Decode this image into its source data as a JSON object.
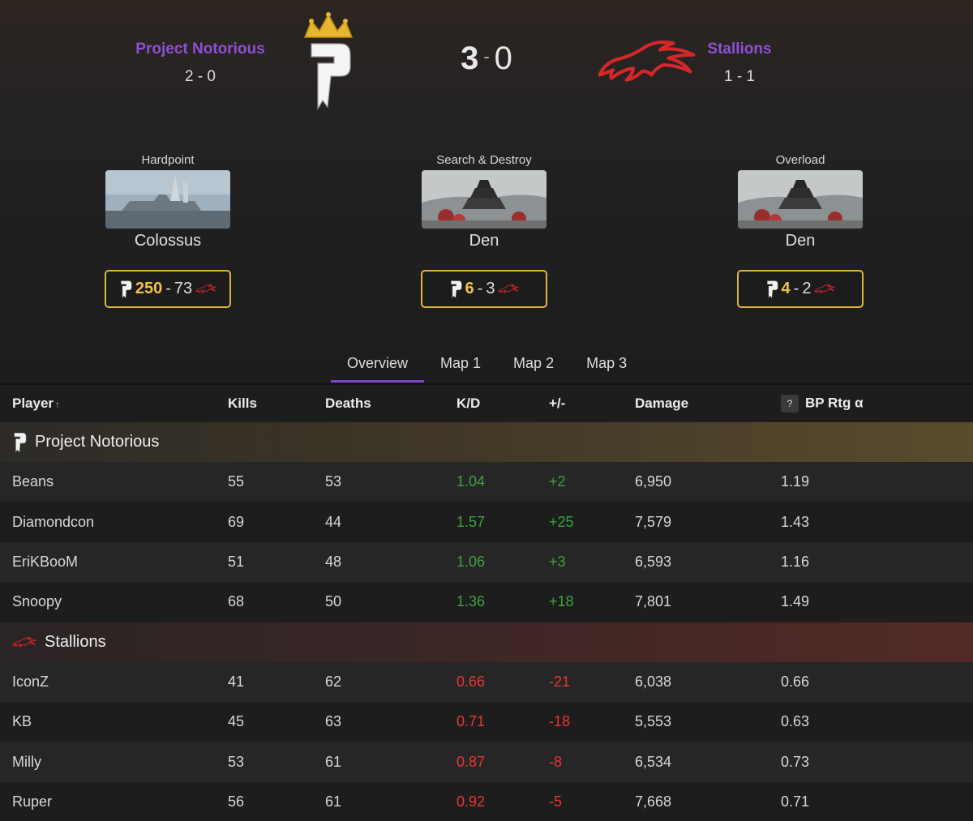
{
  "header": {
    "team1": {
      "name": "Project Notorious",
      "record": "2 - 0"
    },
    "team2": {
      "name": "Stallions",
      "record": "1 - 1"
    },
    "score": {
      "team1": "3",
      "separator": "-",
      "team2": "0"
    }
  },
  "maps": [
    {
      "mode": "Hardpoint",
      "name": "Colossus",
      "score_team1": "250",
      "separator": "-",
      "score_team2": "73"
    },
    {
      "mode": "Search & Destroy",
      "name": "Den",
      "score_team1": "6",
      "separator": "-",
      "score_team2": "3"
    },
    {
      "mode": "Overload",
      "name": "Den",
      "score_team1": "4",
      "separator": "-",
      "score_team2": "2"
    }
  ],
  "tabs": [
    {
      "label": "Overview",
      "active": true
    },
    {
      "label": "Map 1"
    },
    {
      "label": "Map 2"
    },
    {
      "label": "Map 3"
    }
  ],
  "table": {
    "columns": {
      "player": "Player",
      "kills": "Kills",
      "deaths": "Deaths",
      "kd": "K/D",
      "plus_minus": "+/-",
      "damage": "Damage",
      "help": "?",
      "bp_rating": "BP Rtg α"
    },
    "sort_indicator": "↑",
    "groups": [
      {
        "team": "Project Notorious",
        "players": [
          {
            "name": "Beans",
            "kills": "55",
            "deaths": "53",
            "kd": "1.04",
            "plus_minus": "+2",
            "damage": "6,950",
            "bp_rating": "1.19"
          },
          {
            "name": "Diamondcon",
            "kills": "69",
            "deaths": "44",
            "kd": "1.57",
            "plus_minus": "+25",
            "damage": "7,579",
            "bp_rating": "1.43"
          },
          {
            "name": "EriKBooM",
            "kills": "51",
            "deaths": "48",
            "kd": "1.06",
            "plus_minus": "+3",
            "damage": "6,593",
            "bp_rating": "1.16"
          },
          {
            "name": "Snoopy",
            "kills": "68",
            "deaths": "50",
            "kd": "1.36",
            "plus_minus": "+18",
            "damage": "7,801",
            "bp_rating": "1.49"
          }
        ]
      },
      {
        "team": "Stallions",
        "players": [
          {
            "name": "IconZ",
            "kills": "41",
            "deaths": "62",
            "kd": "0.66",
            "plus_minus": "-21",
            "damage": "6,038",
            "bp_rating": "0.66"
          },
          {
            "name": "KB",
            "kills": "45",
            "deaths": "63",
            "kd": "0.71",
            "plus_minus": "-18",
            "damage": "5,553",
            "bp_rating": "0.63"
          },
          {
            "name": "Milly",
            "kills": "53",
            "deaths": "61",
            "kd": "0.87",
            "plus_minus": "-8",
            "damage": "6,534",
            "bp_rating": "0.73"
          },
          {
            "name": "Ruper",
            "kills": "56",
            "deaths": "61",
            "kd": "0.92",
            "plus_minus": "-5",
            "damage": "7,668",
            "bp_rating": "0.71"
          }
        ]
      }
    ]
  },
  "colors": {
    "team1_name": "#8f4fd6",
    "map_score_border": "#e0b53d",
    "positive": "#3fa23f",
    "negative": "#e33a30",
    "tab_underline": "#7c45c4"
  }
}
